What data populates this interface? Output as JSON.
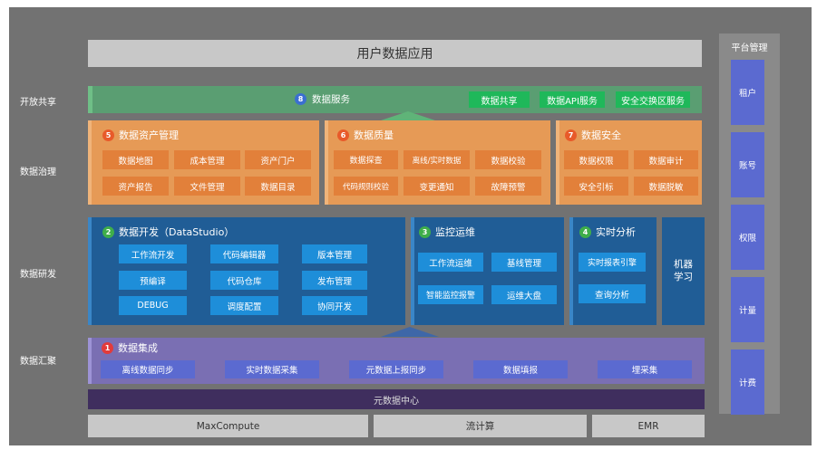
{
  "title": "用户数据应用",
  "row_labels": {
    "open_share": "开放共享",
    "governance": "数据治理",
    "research": "数据研发",
    "collect": "数据汇聚"
  },
  "service": {
    "num": "8",
    "title": "数据服务",
    "buttons": [
      "数据共享",
      "数据API服务",
      "安全交换区服务"
    ]
  },
  "asset": {
    "num": "5",
    "title": "数据资产管理",
    "buttons": [
      "数据地图",
      "成本管理",
      "资产门户",
      "资产报告",
      "文件管理",
      "数据目录"
    ]
  },
  "quality": {
    "num": "6",
    "title": "数据质量",
    "buttons": [
      "数据探查",
      "离线/实时数据",
      "数据校验",
      "代码规则校验",
      "变更通知",
      "故障预警"
    ]
  },
  "security": {
    "num": "7",
    "title": "数据安全",
    "buttons": [
      "数据权限",
      "数据审计",
      "安全引标",
      "数据脱敏"
    ]
  },
  "dev": {
    "num": "2",
    "title": "数据开发（DataStudio）",
    "buttons": [
      "工作流开发",
      "代码编辑器",
      "版本管理",
      "预编译",
      "代码仓库",
      "发布管理",
      "DEBUG",
      "调度配置",
      "协同开发"
    ]
  },
  "monitor": {
    "num": "3",
    "title": "监控运维",
    "buttons": [
      "工作流运维",
      "基线管理",
      "智能监控报警",
      "运维大盘"
    ]
  },
  "realtime": {
    "num": "4",
    "title": "实时分析",
    "buttons": [
      "实时报表引擎",
      "查询分析"
    ]
  },
  "ml": "机器\n学习",
  "integration": {
    "num": "1",
    "title": "数据集成",
    "buttons": [
      "离线数据同步",
      "实时数据采集",
      "元数据上报同步",
      "数据填报",
      "埋采集"
    ]
  },
  "meta_center": "元数据中心",
  "infra": [
    "MaxCompute",
    "流计算",
    "EMR"
  ],
  "platform": {
    "title": "平台管理",
    "buttons": [
      "租户",
      "账号",
      "权限",
      "计量",
      "计费"
    ]
  },
  "colors": {
    "service": "#1fb85a",
    "orange": "#e2803a",
    "blue": "#1e8ed9",
    "purple": "#5b6ad0"
  }
}
